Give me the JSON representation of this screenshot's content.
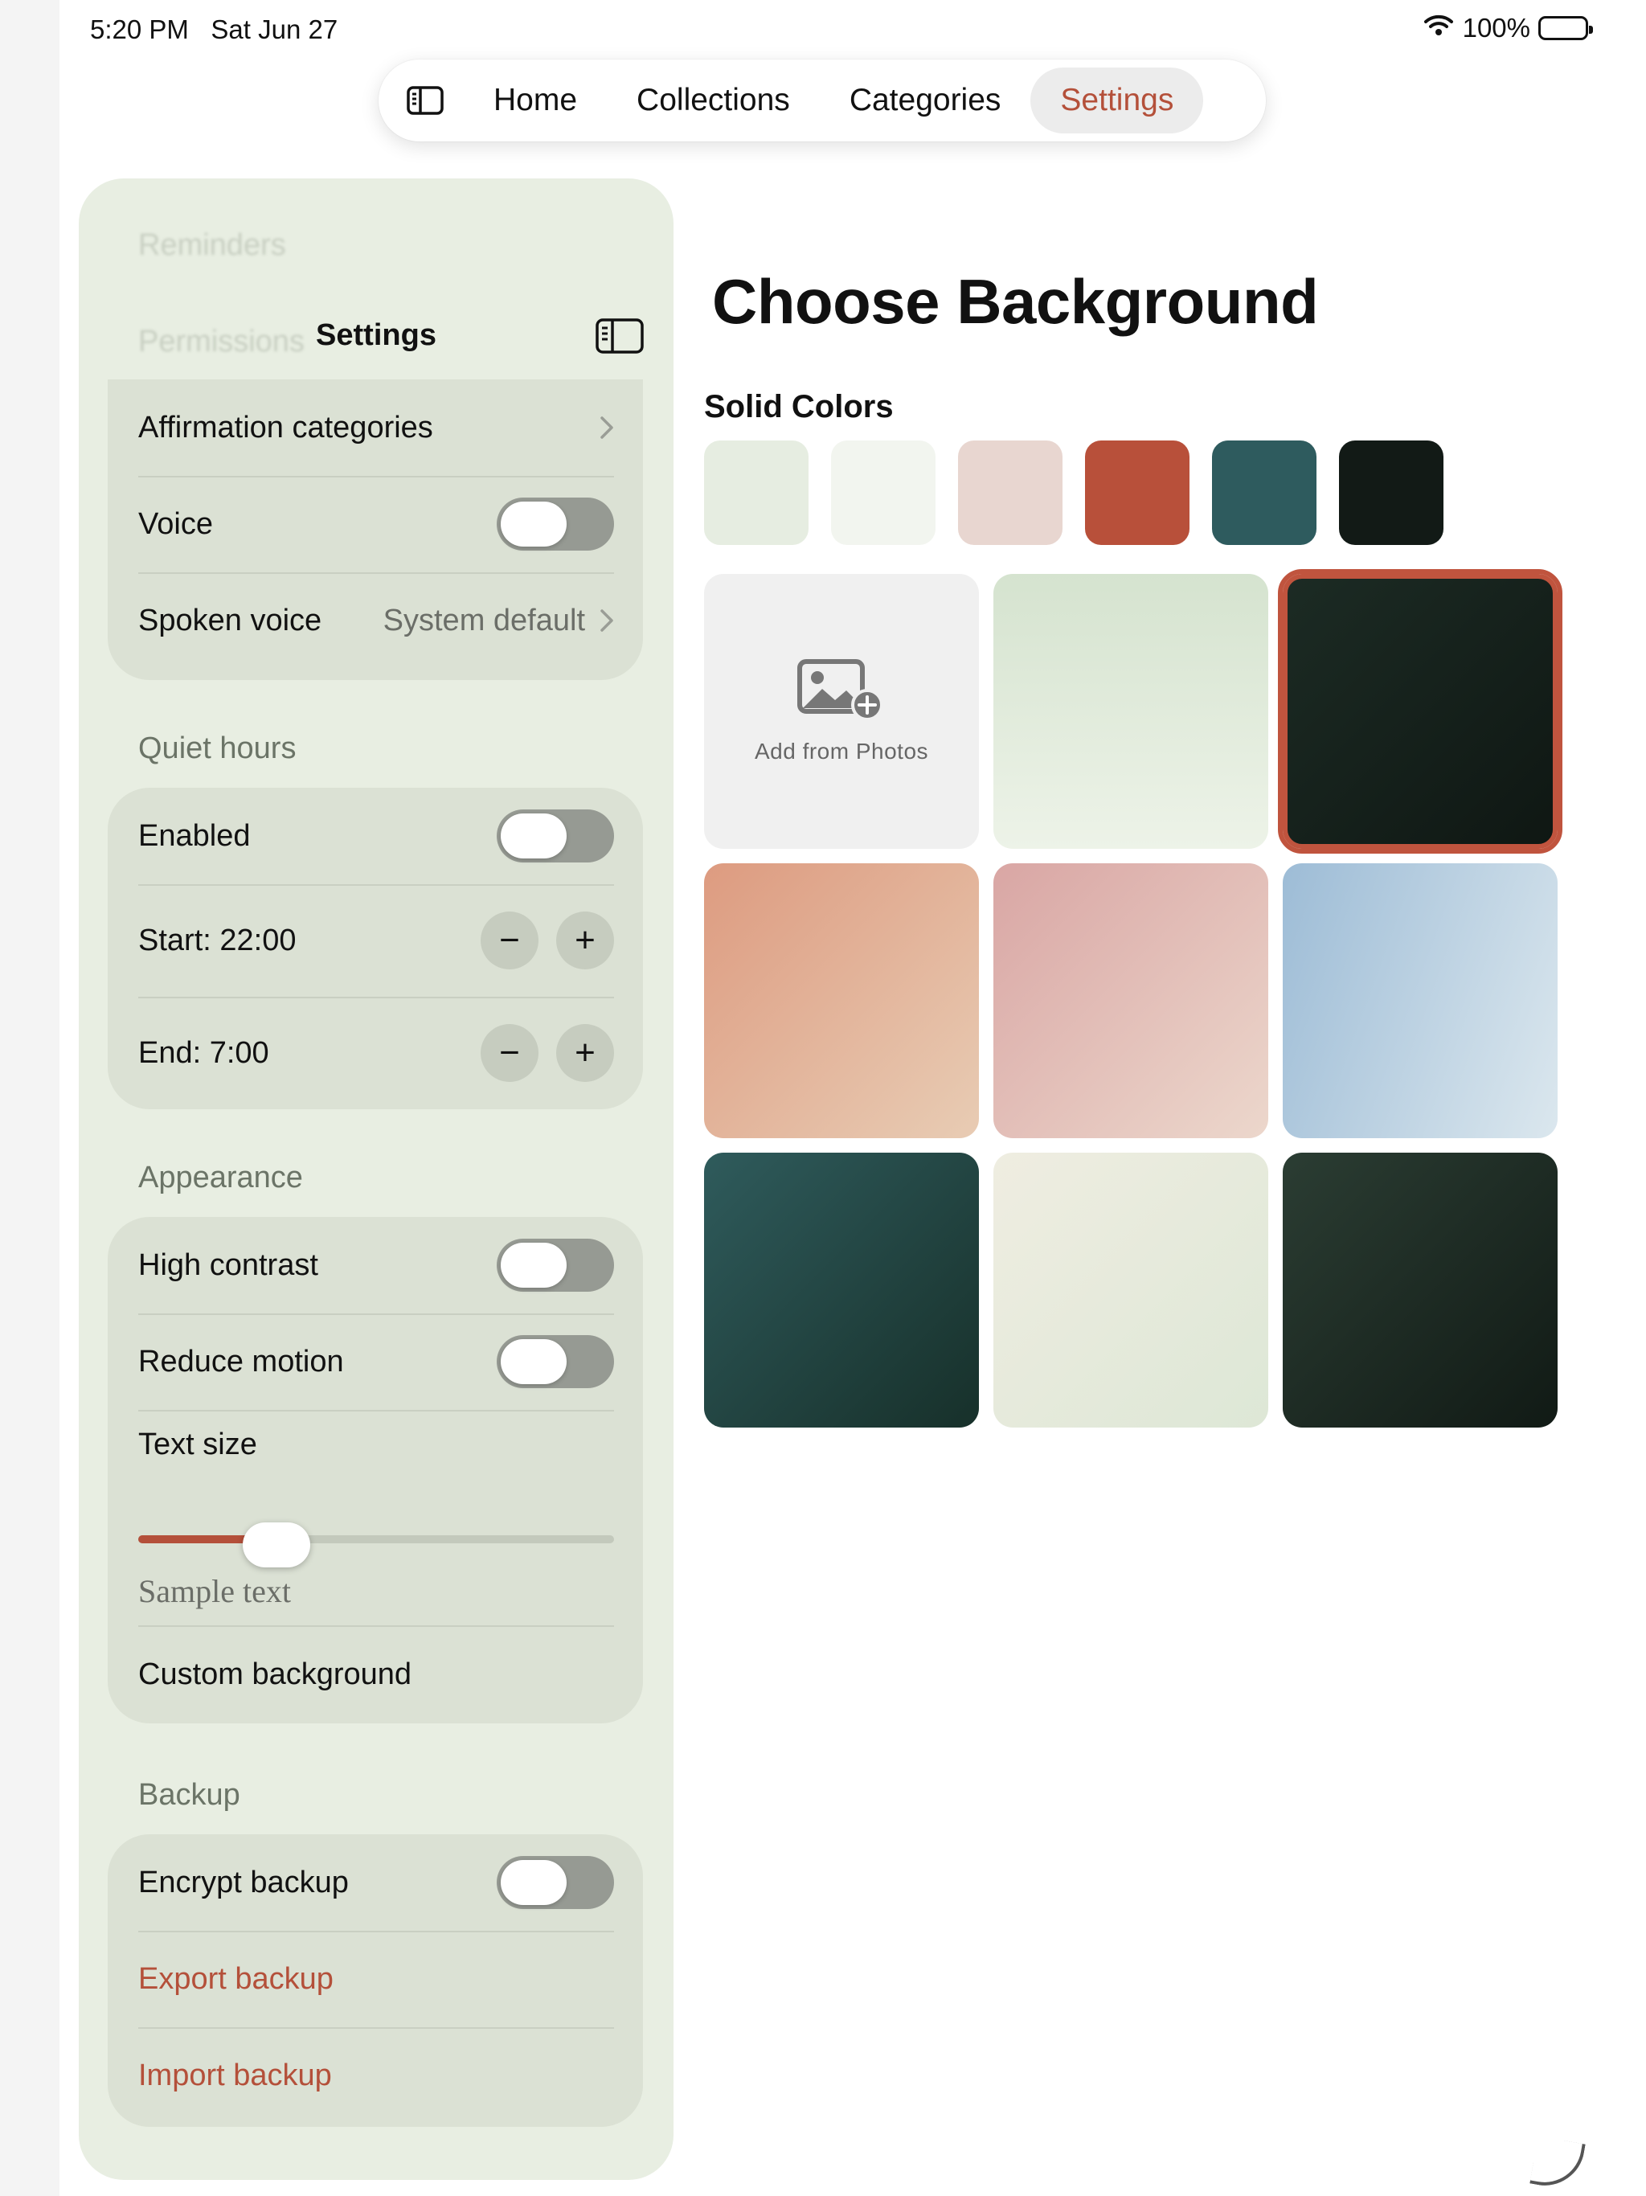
{
  "status": {
    "time": "5:20 PM",
    "date": "Sat Jun 27",
    "battery": "100%",
    "battery_level": 1.0
  },
  "tabbar": {
    "tabs": [
      {
        "label": "Home"
      },
      {
        "label": "Collections"
      },
      {
        "label": "Categories"
      },
      {
        "label": "Settings",
        "active": true
      }
    ]
  },
  "sidebar": {
    "title": "Settings",
    "scrolled_under": [
      "Reminders",
      "Permissions"
    ],
    "general": {
      "affirmation_categories": "Affirmation categories",
      "voice": "Voice",
      "voice_on": false,
      "spoken_voice": "Spoken voice",
      "spoken_voice_value": "System default"
    },
    "quiet_hours": {
      "header": "Quiet hours",
      "enabled": "Enabled",
      "enabled_on": false,
      "start": "Start: 22:00",
      "end": "End: 7:00",
      "minus": "−",
      "plus": "+"
    },
    "appearance": {
      "header": "Appearance",
      "high_contrast": "High contrast",
      "reduce_motion": "Reduce motion",
      "text_size": "Text size",
      "text_size_level": 0.29,
      "sample_text": "Sample text",
      "custom_background": "Custom background"
    },
    "backup": {
      "header": "Backup",
      "encrypt": "Encrypt backup",
      "export": "Export backup",
      "import": "Import backup"
    }
  },
  "main": {
    "title": "Choose Background",
    "solid_colors_label": "Solid Colors",
    "solid_colors": [
      "#e6ede1",
      "#f2f5ef",
      "#e8d6d0",
      "#b8503a",
      "#2e5b5e",
      "#121a16"
    ],
    "add_from_photos": "Add from Photos",
    "gradients": [
      {
        "from": "#d5e3cf",
        "to": "#edf3e8",
        "dir": "180deg"
      },
      {
        "from": "#1c2b24",
        "to": "#0f1713",
        "dir": "135deg",
        "selected": true
      },
      {
        "from": "#dd9b80",
        "to": "#e8ccb4",
        "dir": "135deg"
      },
      {
        "from": "#d9a6a4",
        "to": "#ecd7cc",
        "dir": "135deg"
      },
      {
        "from": "#9dbcd6",
        "to": "#dbe7ee",
        "dir": "110deg"
      },
      {
        "from": "#2f5b5c",
        "to": "#17302a",
        "dir": "135deg"
      },
      {
        "from": "#efede1",
        "to": "#dde7d6",
        "dir": "135deg"
      },
      {
        "from": "#2b3d33",
        "to": "#111a15",
        "dir": "135deg"
      }
    ],
    "accent": "#b4503a"
  }
}
